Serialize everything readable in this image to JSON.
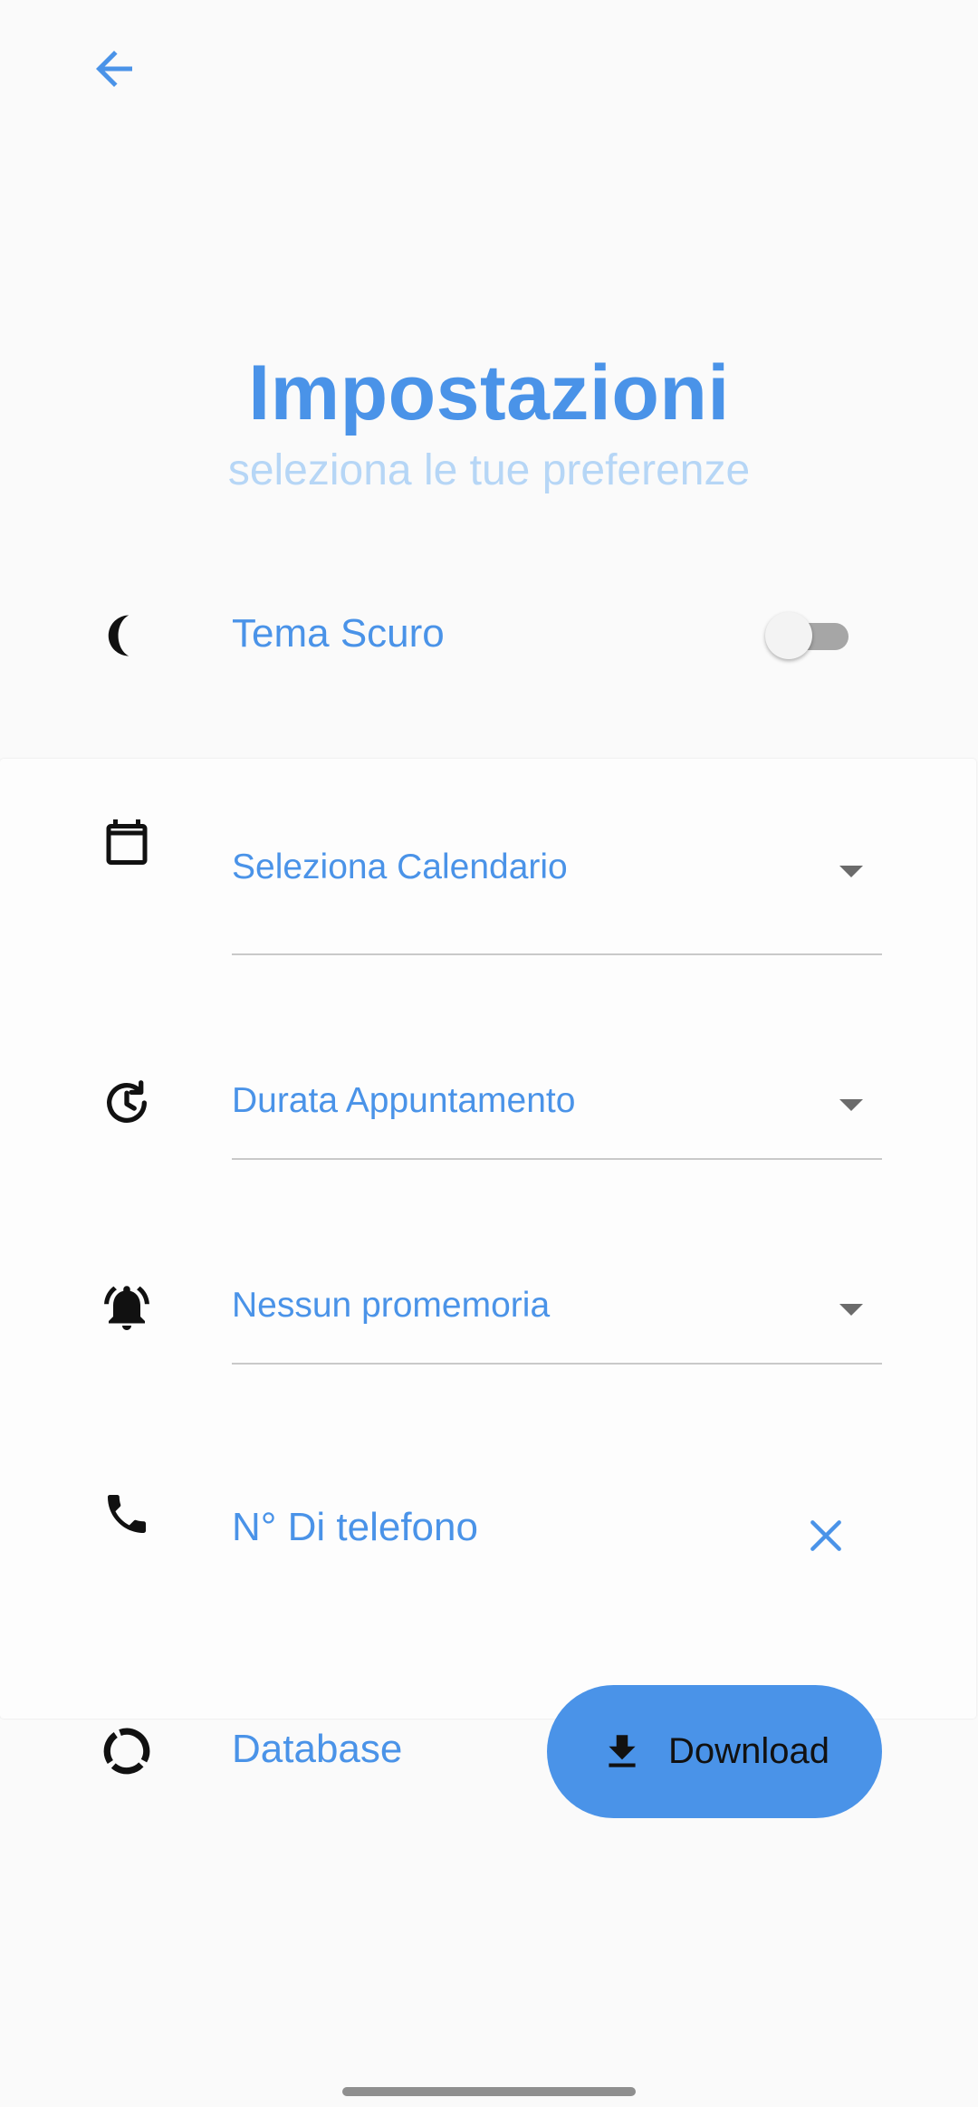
{
  "header": {
    "back_icon": "arrow-back-icon",
    "title": "Impostazioni",
    "subtitle": "seleziona le tue preferenze"
  },
  "settings": {
    "dark_theme": {
      "icon": "moon-icon",
      "label": "Tema Scuro",
      "enabled": false
    },
    "calendar": {
      "icon": "calendar-icon",
      "label": "Seleziona Calendario",
      "arrow_icon": "dropdown-arrow-icon"
    },
    "duration": {
      "icon": "clock-refresh-icon",
      "label": "Durata Appuntamento",
      "arrow_icon": "dropdown-arrow-icon"
    },
    "reminder": {
      "icon": "alarm-bell-icon",
      "label": "Nessun promemoria",
      "arrow_icon": "dropdown-arrow-icon"
    },
    "phone": {
      "icon": "phone-icon",
      "placeholder": "N° Di telefono",
      "clear_icon": "close-icon"
    },
    "database": {
      "icon": "progress-ring-icon",
      "label": "Database",
      "button_label": "Download",
      "button_icon": "download-icon"
    }
  },
  "colors": {
    "accent": "#4a93e8",
    "subtitle": "#b6d6f6",
    "background": "#fafafa",
    "divider": "#c9c9c9"
  }
}
